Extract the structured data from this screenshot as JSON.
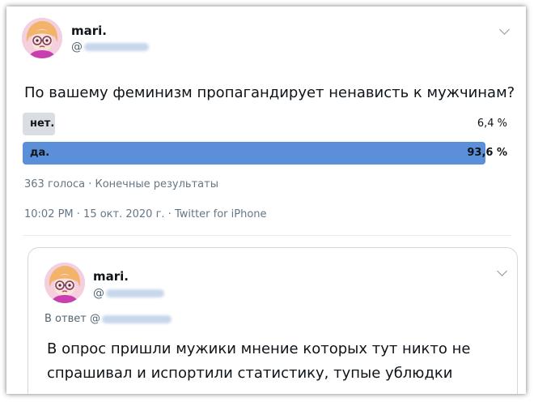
{
  "tweet": {
    "author_name": "mari.",
    "handle_prefix": "@",
    "question": "По вашему феминизм пропагандирует ненависть к мужчинам?",
    "poll": {
      "options": [
        {
          "label": "нет.",
          "percent_text": "6,4 %",
          "percent": 6.4,
          "winner": false
        },
        {
          "label": "да.",
          "percent_text": "93,6 %",
          "percent": 93.6,
          "winner": true
        }
      ],
      "summary": "363 голоса · Конечные результаты"
    },
    "timestamp": "10:02 PM · 15 окт. 2020 г. · Twitter for iPhone"
  },
  "reply": {
    "author_name": "mari.",
    "handle_prefix": "@",
    "in_reply_prefix": "В ответ @",
    "text": "В опрос пришли мужики мнение которых тут никто не спрашивал и испортили статистику, тупые ублюдки"
  },
  "colors": {
    "winner_bar": "#5b8fd9",
    "loser_bar": "#dadde1",
    "muted_text": "#657786"
  },
  "icons": {
    "menu": "chevron-down-icon",
    "avatar": "anime-girl-avatar"
  }
}
